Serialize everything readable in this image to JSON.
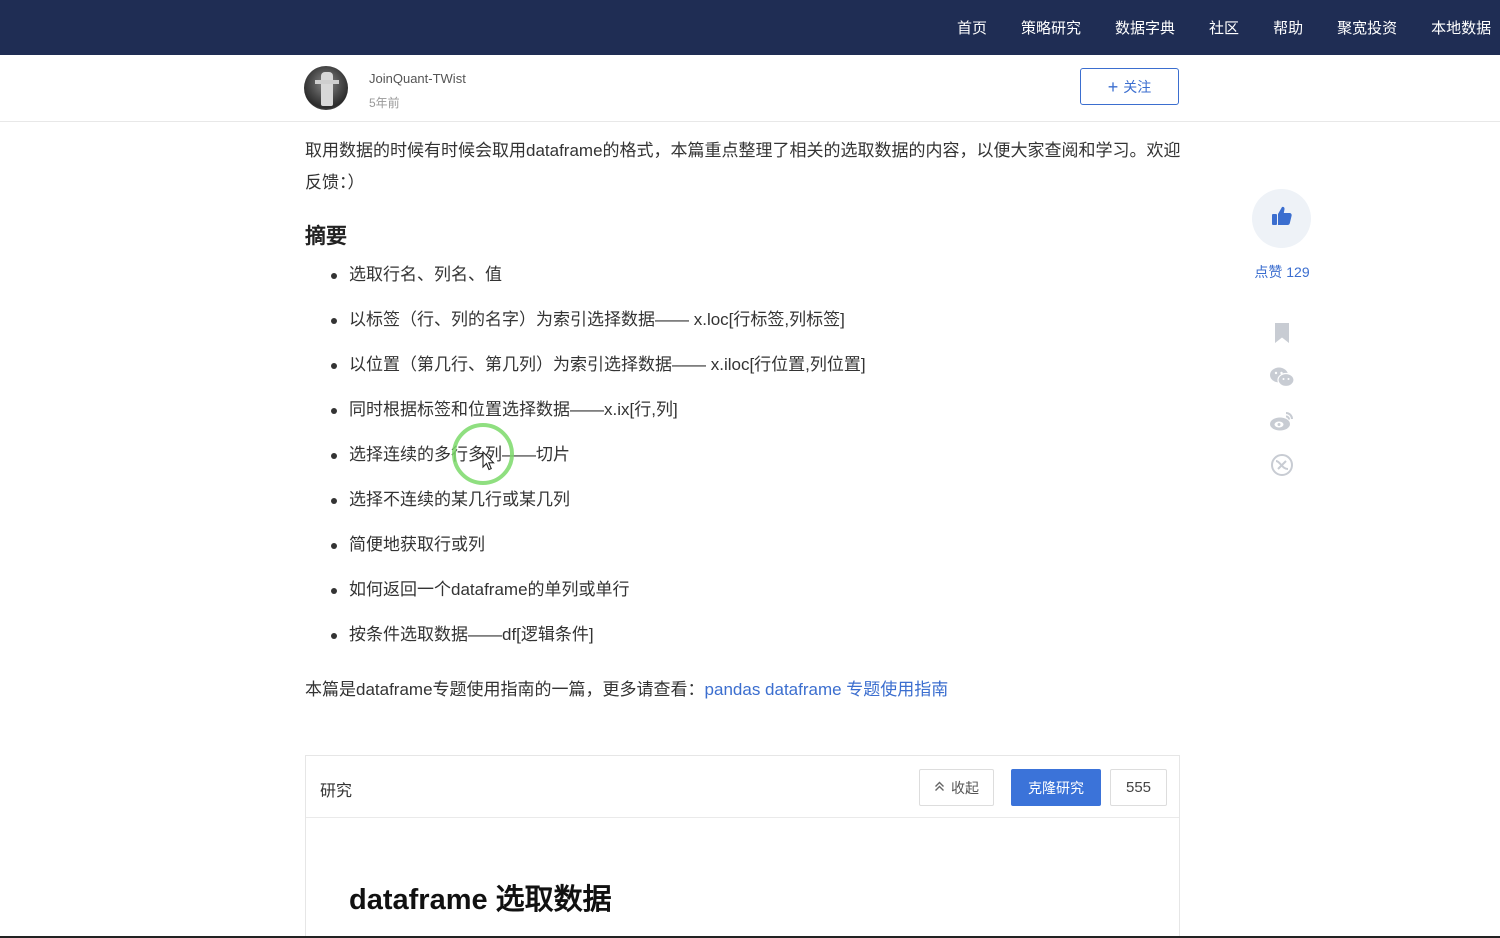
{
  "nav": {
    "items": [
      {
        "label": "首页"
      },
      {
        "label": "策略研究"
      },
      {
        "label": "数据字典"
      },
      {
        "label": "社区"
      },
      {
        "label": "帮助"
      },
      {
        "label": "聚宽投资"
      },
      {
        "label": "本地数据"
      }
    ],
    "background": "#1f2d54"
  },
  "author": {
    "name": "JoinQuant-TWist",
    "time": "5年前",
    "follow_label": "关注",
    "follow_icon": "plus-icon"
  },
  "article": {
    "intro": "取用数据的时候有时候会取用dataframe的格式，本篇重点整理了相关的选取数据的内容，以便大家查阅和学习。欢迎反馈：）",
    "summary_title": "摘要",
    "summary_items": [
      {
        "text": "选取行名、列名、值"
      },
      {
        "text": "以标签（行、列的名字）为索引选择数据—— x.loc[行标签,列标签]"
      },
      {
        "text": "以位置（第几行、第几列）为索引选择数据—— x.iloc[行位置,列位置]"
      },
      {
        "text": "同时根据标签和位置选择数据——x.ix[行,列]"
      },
      {
        "text": "选择连续的多行多列——切片"
      },
      {
        "text": "选择不连续的某几行或某几列"
      },
      {
        "text": "简便地获取行或列"
      },
      {
        "text": "如何返回一个dataframe的单列或单行"
      },
      {
        "text": "按条件选取数据——df[逻辑条件]"
      }
    ],
    "footer_prefix": "本篇是dataframe专题使用指南的一篇，更多请查看：",
    "footer_link": "pandas dataframe 专题使用指南"
  },
  "research": {
    "label": "研究",
    "collapse_label": "收起",
    "clone_label": "克隆研究",
    "count": "555",
    "notebook_title": "dataframe 选取数据"
  },
  "rail": {
    "like_label": "点赞 129",
    "icons": [
      "thumbs-up-icon",
      "bookmark-icon",
      "wechat-icon",
      "weibo-icon",
      "share-icon"
    ]
  },
  "colors": {
    "accent": "#3b6ecf",
    "primary_button": "#3b73d9",
    "cursor_highlight": "#7bd96a"
  }
}
